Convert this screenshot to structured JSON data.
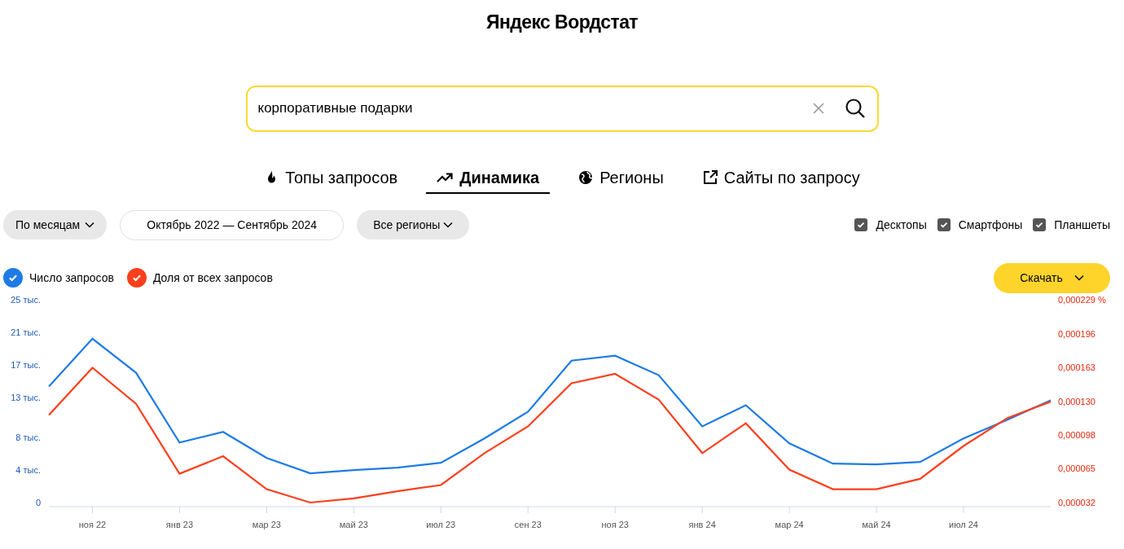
{
  "header": {
    "title": "Яндекс Вордстат"
  },
  "search": {
    "value": "корпоративные подарки"
  },
  "tabs": [
    {
      "label": "Топы запросов",
      "selected": false
    },
    {
      "label": "Динамика",
      "selected": true
    },
    {
      "label": "Регионы",
      "selected": false
    },
    {
      "label": "Сайты по запросу",
      "selected": false
    }
  ],
  "filters": {
    "period": "По месяцам",
    "range": "Октябрь 2022 — Сентябрь 2024",
    "region": "Все регионы"
  },
  "devices": [
    {
      "label": "Десктопы",
      "checked": true
    },
    {
      "label": "Смартфоны",
      "checked": true
    },
    {
      "label": "Планшеты",
      "checked": true
    }
  ],
  "legend": [
    {
      "checked": true
    },
    {
      "checked": true
    }
  ],
  "download_button": "Скачать",
  "chart_data": {
    "type": "line",
    "categories": [
      null,
      "ноя 22",
      null,
      "янв 23",
      null,
      "мар 23",
      null,
      "май 23",
      null,
      "июл 23",
      null,
      "сен 23",
      null,
      "ноя 23",
      null,
      "янв 24",
      null,
      "мар 24",
      null,
      "май 24",
      null,
      "июл 24",
      null,
      null
    ],
    "ylim": [
      0,
      25
    ],
    "yticks": [
      {
        "value": 0,
        "label": "0"
      },
      {
        "value": 4,
        "label": "4 тыс."
      },
      {
        "value": 8,
        "label": "8 тыс."
      },
      {
        "value": 13,
        "label": "13 тыс."
      },
      {
        "value": 17,
        "label": "17 тыс."
      },
      {
        "value": 21,
        "label": "21 тыс."
      },
      {
        "value": 25,
        "label": "25 тыс."
      }
    ],
    "y2lim": [
      3.2e-05,
      0.000229
    ],
    "y2ticks": [
      {
        "value": 3.2e-05,
        "label": "0,000032"
      },
      {
        "value": 6.5e-05,
        "label": "0,000065"
      },
      {
        "value": 9.8e-05,
        "label": "0,000098"
      },
      {
        "value": 0.00013,
        "label": "0,000130"
      },
      {
        "value": 0.000163,
        "label": "0,000163"
      },
      {
        "value": 0.000196,
        "label": "0,000196"
      },
      {
        "value": 0.000229,
        "label": "0,000229 %"
      }
    ],
    "series": [
      {
        "name": "Число запросов",
        "color": "#1e7be6",
        "values": [
          14.3,
          20.2,
          16.0,
          7.4,
          8.7,
          5.5,
          3.6,
          4.0,
          4.3,
          4.9,
          7.9,
          11.2,
          17.5,
          18.1,
          15.7,
          9.4,
          12.0,
          7.3,
          4.8,
          4.7,
          5.0,
          7.9,
          10.2,
          12.6
        ]
      },
      {
        "name": "Доля от всех запросов",
        "color": "#fc3f1d",
        "axis": "y2",
        "values": [
          0.000117,
          0.000163,
          0.000128,
          6e-05,
          7.7e-05,
          4.5e-05,
          3.2e-05,
          3.6e-05,
          4.3e-05,
          4.9e-05,
          8e-05,
          0.000106,
          0.000148,
          0.000157,
          0.000132,
          8e-05,
          0.000109,
          6.4e-05,
          4.5e-05,
          4.5e-05,
          5.5e-05,
          8.7e-05,
          0.000114,
          0.00013
        ]
      }
    ]
  }
}
